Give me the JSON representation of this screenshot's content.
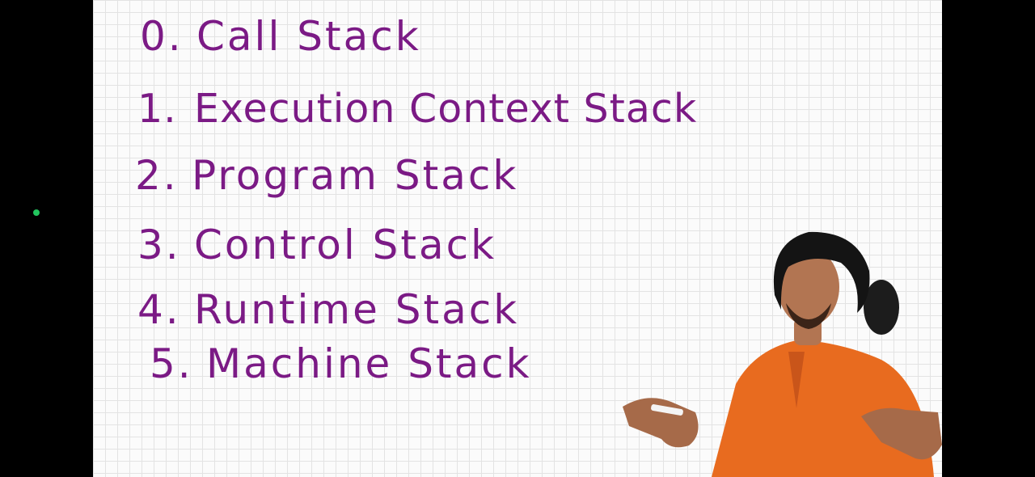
{
  "board": {
    "items": [
      {
        "number": "0.",
        "text": "Call Stack"
      },
      {
        "number": "1.",
        "text": "Execution Context Stack"
      },
      {
        "number": "2.",
        "text": "Program Stack"
      },
      {
        "number": "3.",
        "text": "Control Stack"
      },
      {
        "number": "4.",
        "text": "Runtime Stack"
      },
      {
        "number": "5.",
        "text": "Machine Stack"
      }
    ],
    "ink_color": "#7b1a85"
  },
  "indicator": {
    "color": "#22c55e"
  }
}
